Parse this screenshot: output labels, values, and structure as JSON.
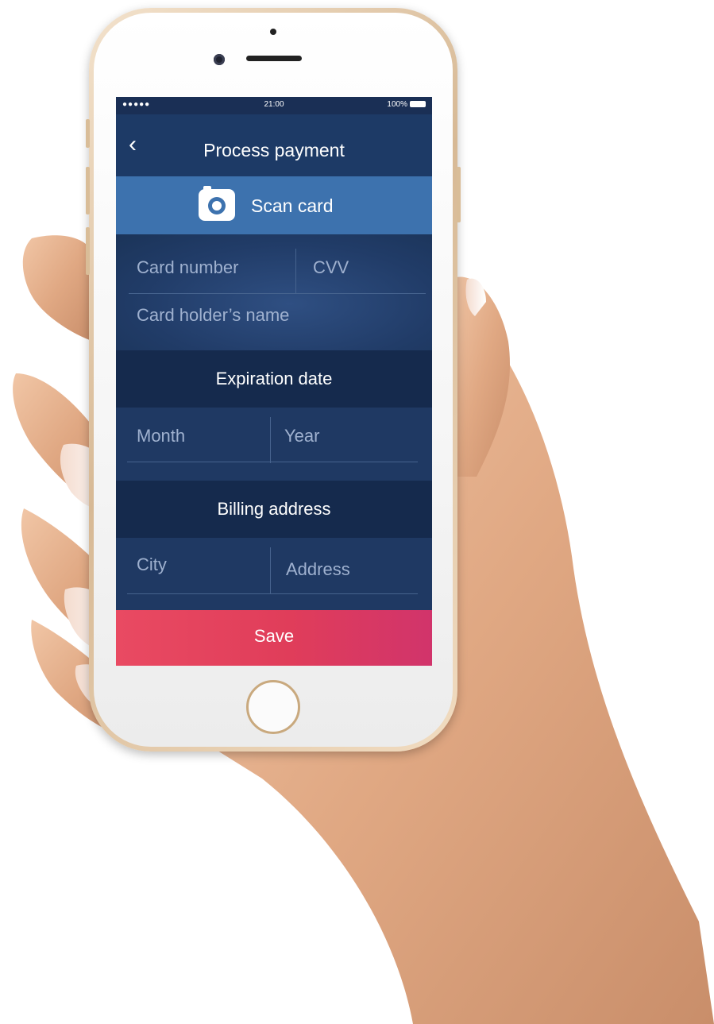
{
  "status_bar": {
    "signal": "●●●●● ",
    "time": "21:00",
    "battery": "100%"
  },
  "nav": {
    "back_icon": "‹",
    "title": "Process payment"
  },
  "scan": {
    "icon": "camera-icon",
    "label": "Scan card"
  },
  "card_fields": {
    "card_number_placeholder": "Card number",
    "cvv_placeholder": "CVV",
    "holder_placeholder": "Card holder’s name"
  },
  "expiration": {
    "heading": "Expiration date",
    "month_placeholder": "Month",
    "year_placeholder": "Year"
  },
  "billing": {
    "heading": "Billing address",
    "city_placeholder": "City",
    "address_placeholder": "Address"
  },
  "actions": {
    "save_label": "Save"
  },
  "colors": {
    "primary": "#1d3a66",
    "scan_button": "#3d72ae",
    "section_header": "#152a4d",
    "save_button": "#e5435e"
  }
}
